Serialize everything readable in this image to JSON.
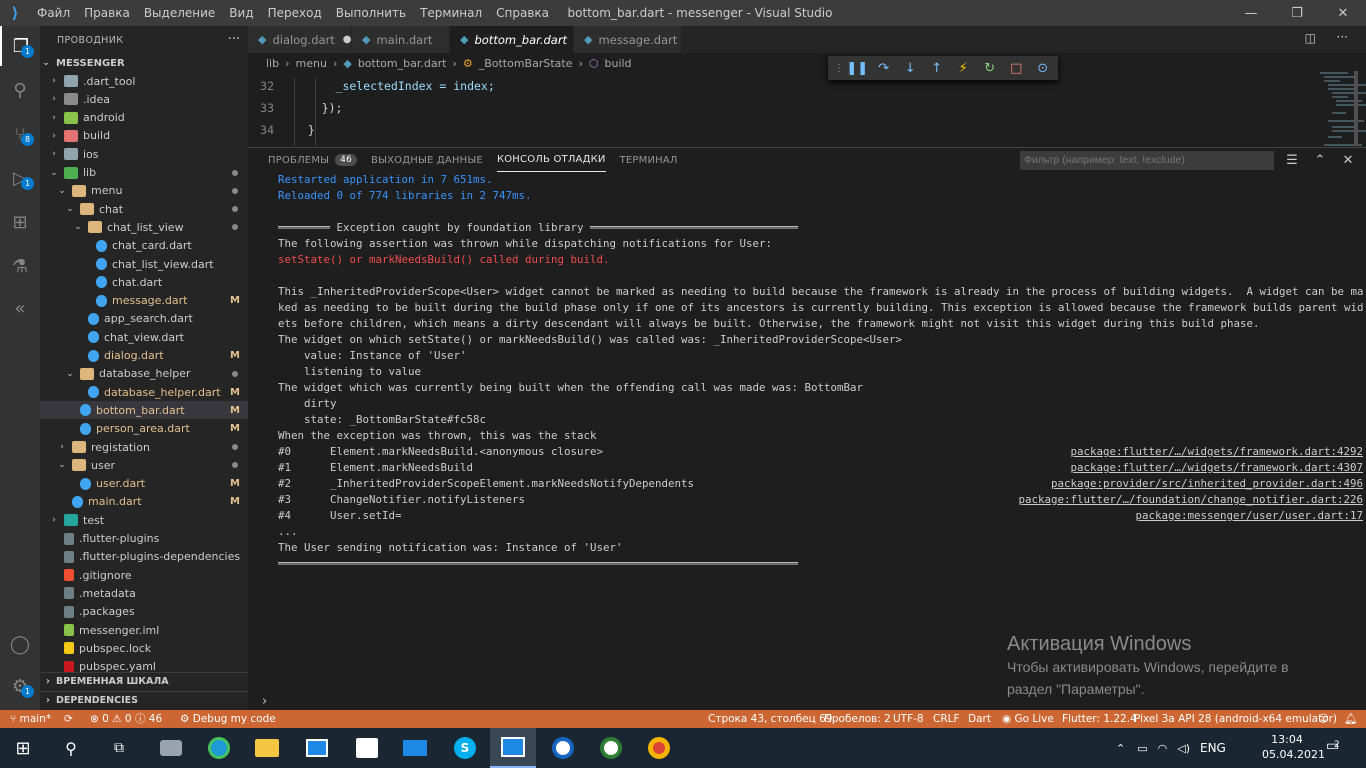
{
  "titlebar": {
    "menu": [
      "Файл",
      "Правка",
      "Выделение",
      "Вид",
      "Переход",
      "Выполнить",
      "Терминал",
      "Справка"
    ],
    "title": "bottom_bar.dart - messenger - Visual Studio Code"
  },
  "activitybar": {
    "explorer_badge": "1",
    "scm_badge": "8",
    "debug_badge": "1",
    "settings_badge": "1"
  },
  "sidebar": {
    "header": "ПРОВОДНИК",
    "project": "MESSENGER",
    "tree": [
      {
        "label": ".dart_tool",
        "indent": 1,
        "type": "folder",
        "color": "#90a4ae"
      },
      {
        "label": ".idea",
        "indent": 1,
        "type": "folder",
        "color": "#8a8a8a"
      },
      {
        "label": "android",
        "indent": 1,
        "type": "folder",
        "color": "#8bc34a"
      },
      {
        "label": "build",
        "indent": 1,
        "type": "folder",
        "color": "#e57373"
      },
      {
        "label": "ios",
        "indent": 1,
        "type": "folder",
        "color": "#90a4ae"
      },
      {
        "label": "lib",
        "indent": 1,
        "type": "folder-open",
        "color": "#4caf50",
        "dot": true
      },
      {
        "label": "menu",
        "indent": 2,
        "type": "folder-open",
        "color": "#dcb67a",
        "dot": true
      },
      {
        "label": "chat",
        "indent": 3,
        "type": "folder-open",
        "color": "#dcb67a",
        "dot": true
      },
      {
        "label": "chat_list_view",
        "indent": 4,
        "type": "folder-open",
        "color": "#dcb67a",
        "dot": true
      },
      {
        "label": "chat_card.dart",
        "indent": 5,
        "type": "dart"
      },
      {
        "label": "chat_list_view.dart",
        "indent": 5,
        "type": "dart"
      },
      {
        "label": "chat.dart",
        "indent": 5,
        "type": "dart"
      },
      {
        "label": "message.dart",
        "indent": 5,
        "type": "dart",
        "mark": "M",
        "modified": true
      },
      {
        "label": "app_search.dart",
        "indent": 4,
        "type": "dart"
      },
      {
        "label": "chat_view.dart",
        "indent": 4,
        "type": "dart"
      },
      {
        "label": "dialog.dart",
        "indent": 4,
        "type": "dart",
        "mark": "M",
        "modified": true
      },
      {
        "label": "database_helper",
        "indent": 3,
        "type": "folder-open",
        "color": "#dcb67a",
        "dot": true
      },
      {
        "label": "database_helper.dart",
        "indent": 4,
        "type": "dart",
        "mark": "M",
        "modified": true
      },
      {
        "label": "bottom_bar.dart",
        "indent": 3,
        "type": "dart",
        "mark": "M",
        "modified": true,
        "selected": true
      },
      {
        "label": "person_area.dart",
        "indent": 3,
        "type": "dart",
        "mark": "M",
        "modified": true
      },
      {
        "label": "registation",
        "indent": 2,
        "type": "folder",
        "color": "#dcb67a",
        "dot": true
      },
      {
        "label": "user",
        "indent": 2,
        "type": "folder-open",
        "color": "#dcb67a",
        "dot": true
      },
      {
        "label": "user.dart",
        "indent": 3,
        "type": "dart",
        "mark": "M",
        "modified": true
      },
      {
        "label": "main.dart",
        "indent": 2,
        "type": "dart",
        "mark": "M",
        "modified": true
      },
      {
        "label": "test",
        "indent": 1,
        "type": "folder",
        "color": "#26a69a"
      },
      {
        "label": ".flutter-plugins",
        "indent": 1,
        "type": "file",
        "color": "#6d8086"
      },
      {
        "label": ".flutter-plugins-dependencies",
        "indent": 1,
        "type": "file",
        "color": "#6d8086"
      },
      {
        "label": ".gitignore",
        "indent": 1,
        "type": "file",
        "color": "#f14e32"
      },
      {
        "label": ".metadata",
        "indent": 1,
        "type": "file",
        "color": "#6d8086"
      },
      {
        "label": ".packages",
        "indent": 1,
        "type": "file",
        "color": "#6d8086"
      },
      {
        "label": "messenger.iml",
        "indent": 1,
        "type": "file",
        "color": "#8bc34a"
      },
      {
        "label": "pubspec.lock",
        "indent": 1,
        "type": "file",
        "color": "#f6c915"
      },
      {
        "label": "pubspec.yaml",
        "indent": 1,
        "type": "file",
        "color": "#cb171e"
      }
    ],
    "timeline": "ВРЕМЕННАЯ ШКАЛА",
    "dependencies": "DEPENDENCIES"
  },
  "tabs": [
    {
      "label": "dialog.dart",
      "dirty": true
    },
    {
      "label": "main.dart"
    },
    {
      "label": "bottom_bar.dart",
      "active": true
    },
    {
      "label": "message.dart"
    }
  ],
  "breadcrumbs": [
    "lib",
    "menu",
    "bottom_bar.dart",
    "_BottomBarState",
    "build"
  ],
  "code": [
    {
      "ln": "32",
      "text": "      _selectedIndex = index;"
    },
    {
      "ln": "33",
      "text": "    });"
    },
    {
      "ln": "34",
      "text": "  }"
    }
  ],
  "panel": {
    "tabs": [
      {
        "label": "ПРОБЛЕМЫ",
        "badge": "46"
      },
      {
        "label": "ВЫХОДНЫЕ ДАННЫЕ"
      },
      {
        "label": "КОНСОЛЬ ОТЛАДКИ",
        "active": true
      },
      {
        "label": "ТЕРМИНАЛ"
      }
    ],
    "filter_placeholder": "Фильтр (например: text, !exclude)"
  },
  "console": [
    {
      "text": "Restarted application in 7 651ms.",
      "style": "blue"
    },
    {
      "text": "Reloaded 0 of 774 libraries in 2 747ms.",
      "style": "blue"
    },
    {
      "text": ""
    },
    {
      "text": "════════ Exception caught by foundation library ════════════════════════════════"
    },
    {
      "text": "The following assertion was thrown while dispatching notifications for User:"
    },
    {
      "text": "setState() or markNeedsBuild() called during build.",
      "style": "red"
    },
    {
      "text": ""
    },
    {
      "text": "This _InheritedProviderScope<User> widget cannot be marked as needing to build because the framework is already in the process of building widgets.  A widget can be mar"
    },
    {
      "text": "ked as needing to be built during the build phase only if one of its ancestors is currently building. This exception is allowed because the framework builds parent widg"
    },
    {
      "text": "ets before children, which means a dirty descendant will always be built. Otherwise, the framework might not visit this widget during this build phase."
    },
    {
      "text": "The widget on which setState() or markNeedsBuild() was called was: _InheritedProviderScope<User>"
    },
    {
      "text": "    value: Instance of 'User'"
    },
    {
      "text": "    listening to value"
    },
    {
      "text": "The widget which was currently being built when the offending call was made was: BottomBar"
    },
    {
      "text": "    dirty"
    },
    {
      "text": "    state: _BottomBarState#fc58c"
    },
    {
      "text": "When the exception was thrown, this was the stack"
    },
    {
      "text": "#0      Element.markNeedsBuild.<anonymous closure>",
      "link": "package:flutter/…/widgets/framework.dart:4292"
    },
    {
      "text": "#1      Element.markNeedsBuild",
      "link": "package:flutter/…/widgets/framework.dart:4307"
    },
    {
      "text": "#2      _InheritedProviderScopeElement.markNeedsNotifyDependents",
      "link": "package:provider/src/inherited_provider.dart:496"
    },
    {
      "text": "#3      ChangeNotifier.notifyListeners",
      "link": "package:flutter/…/foundation/change_notifier.dart:226"
    },
    {
      "text": "#4      User.setId=",
      "link": "package:messenger/user/user.dart:17"
    },
    {
      "text": "..."
    },
    {
      "text": "The User sending notification was: Instance of 'User'"
    },
    {
      "text": "════════════════════════════════════════════════════════════════════════════════"
    }
  ],
  "prompt": "›",
  "watermark": {
    "line1": "Активация Windows",
    "line2": "Чтобы активировать Windows, перейдите в",
    "line3": "раздел \"Параметры\"."
  },
  "statusbar": {
    "branch": "main*",
    "errors": "0",
    "warnings": "0",
    "infos": "46",
    "debug": "Debug my code",
    "position": "Строка 43, столбец 69",
    "spaces": "Пробелов: 2",
    "encoding": "UTF-8",
    "eol": "CRLF",
    "language": "Dart",
    "golive": "Go Live",
    "flutter": "Flutter: 1.22.4",
    "device": "Pixel 3a API 28 (android-x64 emulator)",
    "color": "#cc6633"
  },
  "taskbar": {
    "lang": "ENG",
    "time": "13:04",
    "date": "05.04.2021",
    "notif_count": "2"
  }
}
